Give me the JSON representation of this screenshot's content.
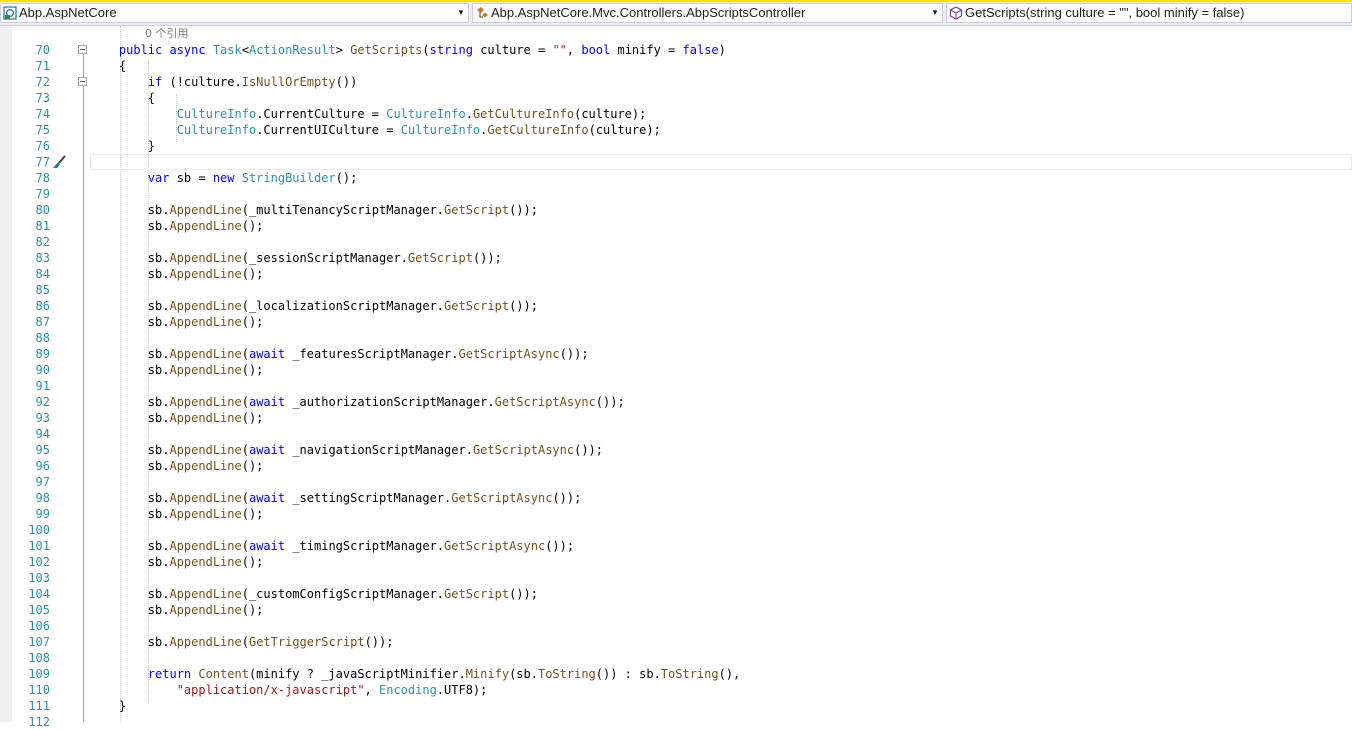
{
  "navbar": {
    "project": "Abp.AspNetCore",
    "type": "Abp.AspNetCore.Mvc.Controllers.AbpScriptsController",
    "member": "GetScripts(string culture = \"\", bool minify = false)"
  },
  "editor": {
    "codelens": "0 个引用",
    "current_line": 77,
    "lines": [
      {
        "n": "70",
        "fold": true,
        "tokens": [
          [
            "    public ",
            "kw"
          ],
          [
            "async ",
            "kw"
          ],
          [
            "Task",
            "ty"
          ],
          [
            "<",
            ""
          ],
          [
            "ActionResult",
            "ty"
          ],
          [
            "> ",
            ""
          ],
          [
            "GetScripts",
            "me"
          ],
          [
            "(",
            ""
          ],
          [
            "string ",
            "kw"
          ],
          [
            "culture = ",
            ""
          ],
          [
            "\"\"",
            "st"
          ],
          [
            ", ",
            ""
          ],
          [
            "bool ",
            "kw"
          ],
          [
            "minify = ",
            ""
          ],
          [
            "false",
            "kw"
          ],
          [
            ")",
            ""
          ]
        ]
      },
      {
        "n": "71",
        "tokens": [
          [
            "    {",
            ""
          ]
        ]
      },
      {
        "n": "72",
        "fold": true,
        "tokens": [
          [
            "        ",
            ""
          ],
          [
            "if ",
            "kw"
          ],
          [
            "(!culture.",
            ""
          ],
          [
            "IsNullOrEmpty",
            "me"
          ],
          [
            "())",
            ""
          ]
        ]
      },
      {
        "n": "73",
        "tokens": [
          [
            "        {",
            ""
          ]
        ]
      },
      {
        "n": "74",
        "tokens": [
          [
            "            ",
            ""
          ],
          [
            "CultureInfo",
            "ty"
          ],
          [
            ".CurrentCulture = ",
            ""
          ],
          [
            "CultureInfo",
            "ty"
          ],
          [
            ".",
            ""
          ],
          [
            "GetCultureInfo",
            "me"
          ],
          [
            "(culture);",
            ""
          ]
        ]
      },
      {
        "n": "75",
        "tokens": [
          [
            "            ",
            ""
          ],
          [
            "CultureInfo",
            "ty"
          ],
          [
            ".CurrentUICulture = ",
            ""
          ],
          [
            "CultureInfo",
            "ty"
          ],
          [
            ".",
            ""
          ],
          [
            "GetCultureInfo",
            "me"
          ],
          [
            "(culture);",
            ""
          ]
        ]
      },
      {
        "n": "76",
        "tokens": [
          [
            "        }",
            ""
          ]
        ]
      },
      {
        "n": "77",
        "brush": true,
        "tokens": []
      },
      {
        "n": "78",
        "tokens": [
          [
            "        ",
            ""
          ],
          [
            "var ",
            "kw"
          ],
          [
            "sb = ",
            ""
          ],
          [
            "new ",
            "kw"
          ],
          [
            "StringBuilder",
            "ty"
          ],
          [
            "();",
            ""
          ]
        ]
      },
      {
        "n": "79",
        "tokens": []
      },
      {
        "n": "80",
        "tokens": [
          [
            "        sb.",
            ""
          ],
          [
            "AppendLine",
            "me"
          ],
          [
            "(_multiTenancyScriptManager.",
            ""
          ],
          [
            "GetScript",
            "me"
          ],
          [
            "());",
            ""
          ]
        ]
      },
      {
        "n": "81",
        "tokens": [
          [
            "        sb.",
            ""
          ],
          [
            "AppendLine",
            "me"
          ],
          [
            "();",
            ""
          ]
        ]
      },
      {
        "n": "82",
        "tokens": []
      },
      {
        "n": "83",
        "tokens": [
          [
            "        sb.",
            ""
          ],
          [
            "AppendLine",
            "me"
          ],
          [
            "(_sessionScriptManager.",
            ""
          ],
          [
            "GetScript",
            "me"
          ],
          [
            "());",
            ""
          ]
        ]
      },
      {
        "n": "84",
        "tokens": [
          [
            "        sb.",
            ""
          ],
          [
            "AppendLine",
            "me"
          ],
          [
            "();",
            ""
          ]
        ]
      },
      {
        "n": "85",
        "tokens": []
      },
      {
        "n": "86",
        "tokens": [
          [
            "        sb.",
            ""
          ],
          [
            "AppendLine",
            "me"
          ],
          [
            "(_localizationScriptManager.",
            ""
          ],
          [
            "GetScript",
            "me"
          ],
          [
            "());",
            ""
          ]
        ]
      },
      {
        "n": "87",
        "tokens": [
          [
            "        sb.",
            ""
          ],
          [
            "AppendLine",
            "me"
          ],
          [
            "();",
            ""
          ]
        ]
      },
      {
        "n": "88",
        "tokens": []
      },
      {
        "n": "89",
        "tokens": [
          [
            "        sb.",
            ""
          ],
          [
            "AppendLine",
            "me"
          ],
          [
            "(",
            ""
          ],
          [
            "await ",
            "kw"
          ],
          [
            "_featuresScriptManager.",
            ""
          ],
          [
            "GetScriptAsync",
            "me"
          ],
          [
            "());",
            ""
          ]
        ]
      },
      {
        "n": "90",
        "tokens": [
          [
            "        sb.",
            ""
          ],
          [
            "AppendLine",
            "me"
          ],
          [
            "();",
            ""
          ]
        ]
      },
      {
        "n": "91",
        "tokens": []
      },
      {
        "n": "92",
        "tokens": [
          [
            "        sb.",
            ""
          ],
          [
            "AppendLine",
            "me"
          ],
          [
            "(",
            ""
          ],
          [
            "await ",
            "kw"
          ],
          [
            "_authorizationScriptManager.",
            ""
          ],
          [
            "GetScriptAsync",
            "me"
          ],
          [
            "());",
            ""
          ]
        ]
      },
      {
        "n": "93",
        "tokens": [
          [
            "        sb.",
            ""
          ],
          [
            "AppendLine",
            "me"
          ],
          [
            "();",
            ""
          ]
        ]
      },
      {
        "n": "94",
        "tokens": []
      },
      {
        "n": "95",
        "tokens": [
          [
            "        sb.",
            ""
          ],
          [
            "AppendLine",
            "me"
          ],
          [
            "(",
            ""
          ],
          [
            "await ",
            "kw"
          ],
          [
            "_navigationScriptManager.",
            ""
          ],
          [
            "GetScriptAsync",
            "me"
          ],
          [
            "());",
            ""
          ]
        ]
      },
      {
        "n": "96",
        "tokens": [
          [
            "        sb.",
            ""
          ],
          [
            "AppendLine",
            "me"
          ],
          [
            "();",
            ""
          ]
        ]
      },
      {
        "n": "97",
        "tokens": []
      },
      {
        "n": "98",
        "tokens": [
          [
            "        sb.",
            ""
          ],
          [
            "AppendLine",
            "me"
          ],
          [
            "(",
            ""
          ],
          [
            "await ",
            "kw"
          ],
          [
            "_settingScriptManager.",
            ""
          ],
          [
            "GetScriptAsync",
            "me"
          ],
          [
            "());",
            ""
          ]
        ]
      },
      {
        "n": "99",
        "tokens": [
          [
            "        sb.",
            ""
          ],
          [
            "AppendLine",
            "me"
          ],
          [
            "();",
            ""
          ]
        ]
      },
      {
        "n": "100",
        "tokens": []
      },
      {
        "n": "101",
        "tokens": [
          [
            "        sb.",
            ""
          ],
          [
            "AppendLine",
            "me"
          ],
          [
            "(",
            ""
          ],
          [
            "await ",
            "kw"
          ],
          [
            "_timingScriptManager.",
            ""
          ],
          [
            "GetScriptAsync",
            "me"
          ],
          [
            "());",
            ""
          ]
        ]
      },
      {
        "n": "102",
        "tokens": [
          [
            "        sb.",
            ""
          ],
          [
            "AppendLine",
            "me"
          ],
          [
            "();",
            ""
          ]
        ]
      },
      {
        "n": "103",
        "tokens": []
      },
      {
        "n": "104",
        "tokens": [
          [
            "        sb.",
            ""
          ],
          [
            "AppendLine",
            "me"
          ],
          [
            "(_customConfigScriptManager.",
            ""
          ],
          [
            "GetScript",
            "me"
          ],
          [
            "());",
            ""
          ]
        ]
      },
      {
        "n": "105",
        "tokens": [
          [
            "        sb.",
            ""
          ],
          [
            "AppendLine",
            "me"
          ],
          [
            "();",
            ""
          ]
        ]
      },
      {
        "n": "106",
        "tokens": []
      },
      {
        "n": "107",
        "tokens": [
          [
            "        sb.",
            ""
          ],
          [
            "AppendLine",
            "me"
          ],
          [
            "(",
            ""
          ],
          [
            "GetTriggerScript",
            "me"
          ],
          [
            "());",
            ""
          ]
        ]
      },
      {
        "n": "108",
        "tokens": []
      },
      {
        "n": "109",
        "tokens": [
          [
            "        ",
            ""
          ],
          [
            "return ",
            "kw"
          ],
          [
            "Content",
            "me"
          ],
          [
            "(minify ? _javaScriptMinifier.",
            ""
          ],
          [
            "Minify",
            "me"
          ],
          [
            "(sb.",
            ""
          ],
          [
            "ToString",
            "me"
          ],
          [
            "()) : sb.",
            ""
          ],
          [
            "ToString",
            "me"
          ],
          [
            "(),",
            ""
          ]
        ]
      },
      {
        "n": "110",
        "tokens": [
          [
            "            ",
            ""
          ],
          [
            "\"application/x-javascript\"",
            "st"
          ],
          [
            ", ",
            ""
          ],
          [
            "Encoding",
            "ty"
          ],
          [
            ".UTF8);",
            ""
          ]
        ]
      },
      {
        "n": "111",
        "tokens": [
          [
            "    }",
            ""
          ]
        ]
      },
      {
        "n": "112",
        "tokens": []
      }
    ]
  },
  "colors": {
    "keyword": "#0000ff",
    "type": "#2b91af",
    "method": "#74531f",
    "string": "#a31515",
    "line_number": "#2b91af"
  }
}
